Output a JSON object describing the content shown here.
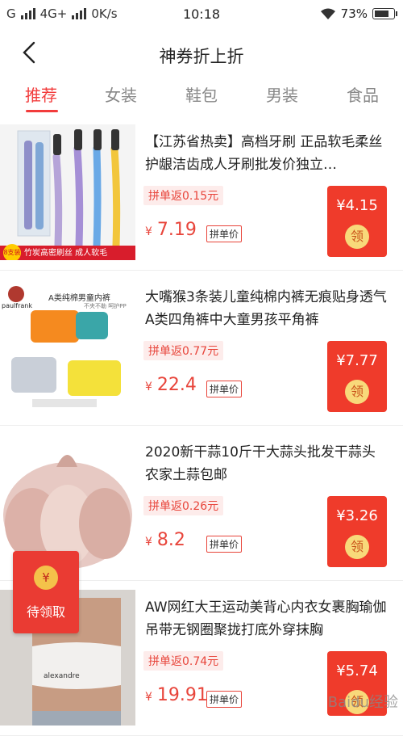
{
  "status": {
    "carrier": "G",
    "network": "4G+",
    "speed": "0K/s",
    "time": "10:18",
    "battery": "73%"
  },
  "header": {
    "title": "神券折上折"
  },
  "tabs": [
    {
      "label": "推荐"
    },
    {
      "label": "女装"
    },
    {
      "label": "鞋包"
    },
    {
      "label": "男装"
    },
    {
      "label": "食品"
    }
  ],
  "products": [
    {
      "title": "【江苏省热卖】高档牙刷 正品软毛柔丝护龈洁齿成人牙刷批发价独立…",
      "rebate": "拼单返0.15元",
      "price_symbol": "¥",
      "price": "7.19",
      "tag": "拼单价",
      "coupon": "¥4.15",
      "claim": "领",
      "img": {
        "badge": "8支装",
        "caption": "竹炭高密刷丝  成人软毛"
      }
    },
    {
      "title": "大嘴猴3条装儿童纯棉内裤无痕贴身透气A类四角裤中大童男孩平角裤",
      "rebate": "拼单返0.77元",
      "price_symbol": "¥",
      "price": "22.4",
      "tag": "拼单价",
      "coupon": "¥7.77",
      "claim": "领",
      "img": {
        "brand": "paulfrank",
        "caption": "A类纯棉男童内裤",
        "sub": "不夹不勒 呵护PP"
      }
    },
    {
      "title": "2020新干蒜10斤干大蒜头批发干蒜头农家土蒜包邮",
      "rebate": "拼单返0.26元",
      "price_symbol": "¥",
      "price": "8.2",
      "tag": "拼单价",
      "coupon": "¥3.26",
      "claim": "领",
      "img": {}
    },
    {
      "title": "AW网红大王运动美背心内衣女裹胸瑜伽吊带无钢圈聚拢打底外穿抹胸",
      "rebate": "拼单返0.74元",
      "price_symbol": "¥",
      "price": "19.91",
      "tag": "拼单价",
      "coupon": "¥5.74",
      "claim": "领",
      "img": {
        "print": "alexandre"
      }
    }
  ],
  "floating": {
    "coin": "¥",
    "label": "待领取"
  },
  "watermark": "Baidu经验"
}
